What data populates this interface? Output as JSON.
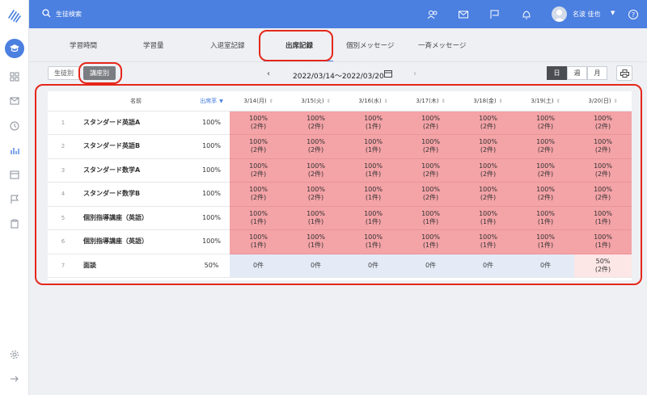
{
  "search": {
    "placeholder": "生徒検索"
  },
  "user": {
    "name": "名波 佳也"
  },
  "tabs": [
    {
      "label": "学習時間"
    },
    {
      "label": "学習量"
    },
    {
      "label": "入退室記録"
    },
    {
      "label": "出席記録"
    },
    {
      "label": "個別メッセージ"
    },
    {
      "label": "一斉メッセージ"
    }
  ],
  "view_modes": {
    "student": "生徒別",
    "course": "講座別"
  },
  "date_range": "2022/03/14〜2022/03/20",
  "period": {
    "day": "日",
    "week": "週",
    "month": "月"
  },
  "table": {
    "headers": {
      "name": "名前",
      "rate": "出席率",
      "dates": [
        "3/14(月)",
        "3/15(火)",
        "3/16(水)",
        "3/17(木)",
        "3/18(金)",
        "3/19(土)",
        "3/20(日)"
      ]
    },
    "rows": [
      {
        "no": "1",
        "name": "スタンダード英語A",
        "rate": "100%",
        "cells": [
          [
            "100%",
            "(2件)"
          ],
          [
            "100%",
            "(2件)"
          ],
          [
            "100%",
            "(1件)"
          ],
          [
            "100%",
            "(2件)"
          ],
          [
            "100%",
            "(2件)"
          ],
          [
            "100%",
            "(2件)"
          ],
          [
            "100%",
            "(2件)"
          ]
        ]
      },
      {
        "no": "2",
        "name": "スタンダード英語B",
        "rate": "100%",
        "cells": [
          [
            "100%",
            "(2件)"
          ],
          [
            "100%",
            "(2件)"
          ],
          [
            "100%",
            "(1件)"
          ],
          [
            "100%",
            "(2件)"
          ],
          [
            "100%",
            "(2件)"
          ],
          [
            "100%",
            "(2件)"
          ],
          [
            "100%",
            "(2件)"
          ]
        ]
      },
      {
        "no": "3",
        "name": "スタンダード数学A",
        "rate": "100%",
        "cells": [
          [
            "100%",
            "(2件)"
          ],
          [
            "100%",
            "(2件)"
          ],
          [
            "100%",
            "(1件)"
          ],
          [
            "100%",
            "(2件)"
          ],
          [
            "100%",
            "(2件)"
          ],
          [
            "100%",
            "(2件)"
          ],
          [
            "100%",
            "(2件)"
          ]
        ]
      },
      {
        "no": "4",
        "name": "スタンダード数学B",
        "rate": "100%",
        "cells": [
          [
            "100%",
            "(2件)"
          ],
          [
            "100%",
            "(2件)"
          ],
          [
            "100%",
            "(1件)"
          ],
          [
            "100%",
            "(2件)"
          ],
          [
            "100%",
            "(2件)"
          ],
          [
            "100%",
            "(2件)"
          ],
          [
            "100%",
            "(2件)"
          ]
        ]
      },
      {
        "no": "5",
        "name": "個別指導講座（英語）",
        "rate": "100%",
        "cells": [
          [
            "100%",
            "(1件)"
          ],
          [
            "100%",
            "(1件)"
          ],
          [
            "100%",
            "(1件)"
          ],
          [
            "100%",
            "(1件)"
          ],
          [
            "100%",
            "(1件)"
          ],
          [
            "100%",
            "(1件)"
          ],
          [
            "100%",
            "(1件)"
          ]
        ]
      },
      {
        "no": "6",
        "name": "個別指導講座（英語）",
        "rate": "100%",
        "cells": [
          [
            "100%",
            "(1件)"
          ],
          [
            "100%",
            "(1件)"
          ],
          [
            "100%",
            "(1件)"
          ],
          [
            "100%",
            "(1件)"
          ],
          [
            "100%",
            "(1件)"
          ],
          [
            "100%",
            "(1件)"
          ],
          [
            "100%",
            "(1件)"
          ]
        ]
      },
      {
        "no": "7",
        "name": "面談",
        "rate": "50%",
        "cells": [
          [
            "0件"
          ],
          [
            "0件"
          ],
          [
            "0件"
          ],
          [
            "0件"
          ],
          [
            "0件"
          ],
          [
            "0件"
          ],
          [
            "50%",
            "(2件)"
          ]
        ]
      }
    ]
  },
  "colors": {
    "accent": "#4b7fe0",
    "full": "#f4a3a7",
    "zero": "#e4ebf7",
    "partial": "#fde6e6",
    "annotation": "#e5271b"
  }
}
